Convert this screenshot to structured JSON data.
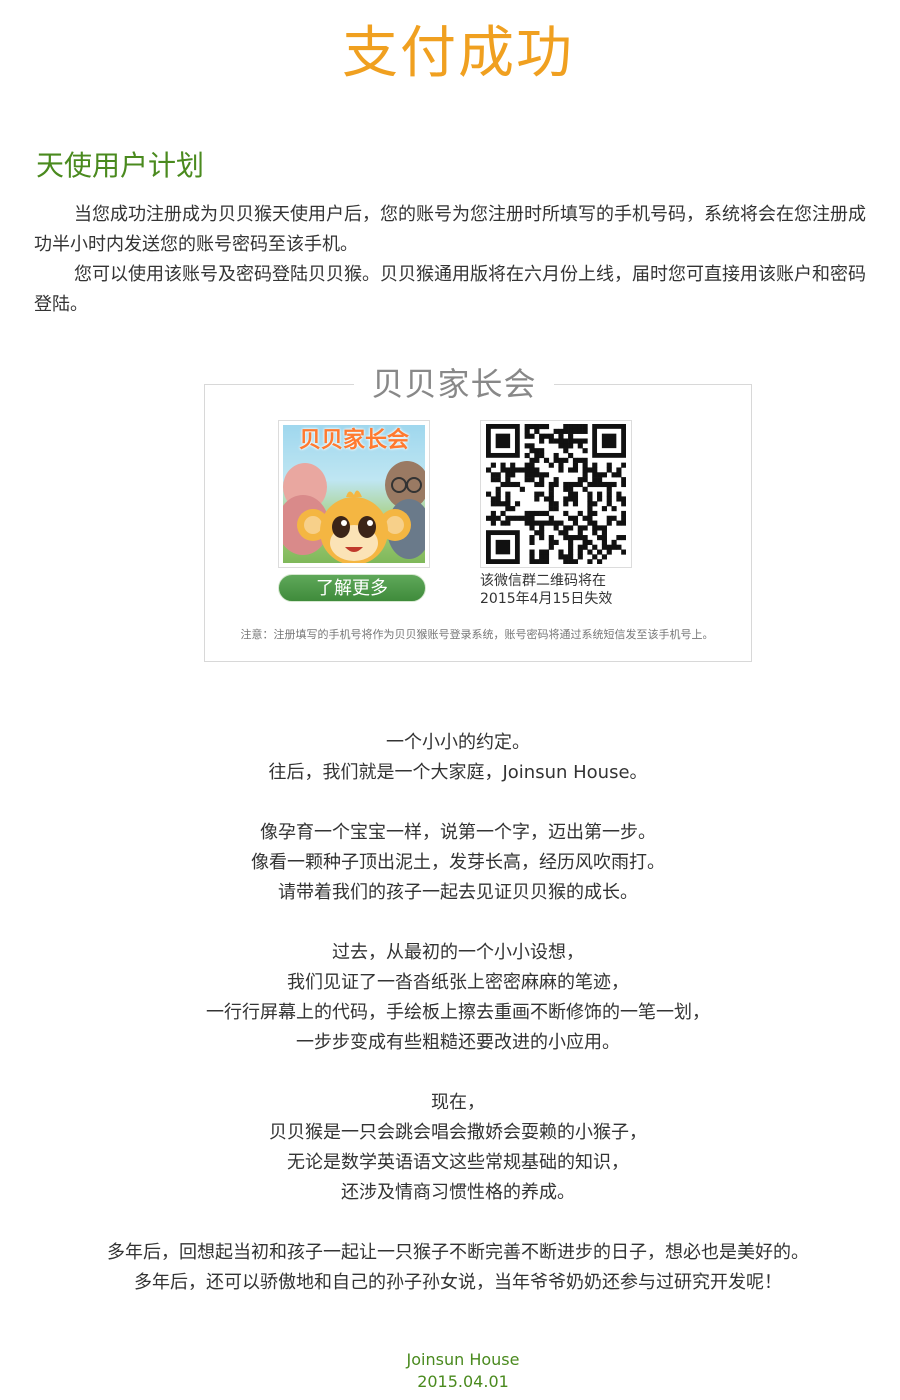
{
  "header": {
    "title": "支付成功"
  },
  "angel_plan": {
    "title": "天使用户计划",
    "paragraph1": "当您成功注册成为贝贝猴天使用户后，您的账号为您注册时所填写的手机号码，系统将会在您注册成功半小时内发送您的账号密码至该手机。",
    "paragraph2": "您可以使用该账号及密码登陆贝贝猴。贝贝猴通用版将在六月份上线，届时您可直接用该账户和密码登陆。"
  },
  "parent_club": {
    "title": "贝贝家长会",
    "app_logo_text": "贝贝家长会",
    "learn_more_label": "了解更多",
    "qr_caption_line1": "该微信群二维码将在",
    "qr_caption_line2": "2015年4月15日失效",
    "note": "注意：注册填写的手机号将作为贝贝猴账号登录系统，账号密码将通过系统短信发至该手机号上。"
  },
  "story": {
    "lines": [
      "一个小小的约定。",
      "往后，我们就是一个大家庭，Joinsun House。",
      "像孕育一个宝宝一样，说第一个字，迈出第一步。",
      "像看一颗种子顶出泥土，发芽长高，经历风吹雨打。",
      "请带着我们的孩子一起去见证贝贝猴的成长。",
      "过去，从最初的一个小小设想，",
      "我们见证了一沓沓纸张上密密麻麻的笔迹，",
      "一行行屏幕上的代码，手绘板上擦去重画不断修饰的一笔一划，",
      "一步步变成有些粗糙还要改进的小应用。",
      "现在，",
      "贝贝猴是一只会跳会唱会撒娇会耍赖的小猴子，",
      "无论是数学英语语文这些常规基础的知识，",
      "还涉及情商习惯性格的养成。",
      "多年后，回想起当初和孩子一起让一只猴子不断完善不断进步的日子，想必也是美好的。",
      "多年后，还可以骄傲地和自己的孙子孙女说，当年爷爷奶奶还参与过研究开发呢！"
    ]
  },
  "signature": {
    "name": "Joinsun House",
    "date": "2015.04.01"
  },
  "colors": {
    "title_orange": "#f0a020",
    "brand_green": "#4a8a1e",
    "button_green": "#4f9a4a"
  }
}
